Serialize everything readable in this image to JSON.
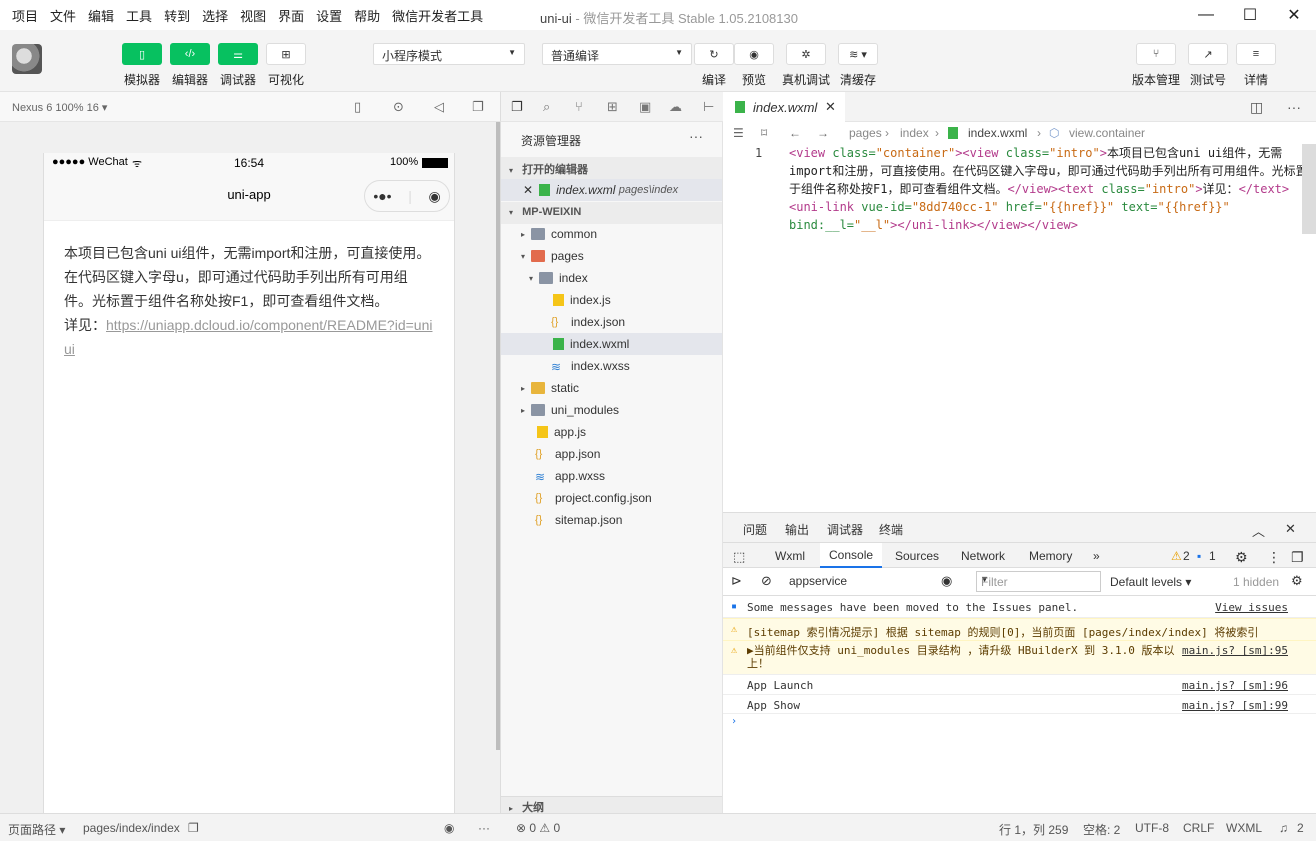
{
  "menubar": {
    "items": [
      "项目",
      "文件",
      "编辑",
      "工具",
      "转到",
      "选择",
      "视图",
      "界面",
      "设置",
      "帮助",
      "微信开发者工具"
    ],
    "title": "uni-ui",
    "subtitle": "- 微信开发者工具 Stable 1.05.2108130"
  },
  "toolbar": {
    "simulator": "模拟器",
    "editor": "编辑器",
    "debugger": "调试器",
    "visual": "可视化",
    "mode_select": "小程序模式",
    "compile_select": "普通编译",
    "compile": "编译",
    "preview": "预览",
    "real_debug": "真机调试",
    "clear_cache": "清缓存",
    "version_mgmt": "版本管理",
    "test_account": "测试号",
    "details": "详情"
  },
  "simulator": {
    "device": "Nexus 6 100% 16 ▾",
    "status_carrier": "●●●●● WeChat",
    "status_time": "16:54",
    "status_battery": "100%",
    "nav_title": "uni-app",
    "content_text": "本项目已包含uni ui组件，无需import和注册，可直接使用。在代码区键入字母u，即可通过代码助手列出所有可用组件。光标置于组件名称处按F1，即可查看组件文档。",
    "see_label": "详见：",
    "link": "https://uniapp.dcloud.io/component/README?id=uniui"
  },
  "explorer": {
    "title": "资源管理器",
    "open_editors": "打开的编辑器",
    "open_file": "index.wxml",
    "open_file_path": "pages\\index",
    "project": "MP-WEIXIN",
    "tree": [
      "common",
      "pages",
      "index",
      "index.js",
      "index.json",
      "index.wxml",
      "index.wxss",
      "static",
      "uni_modules",
      "app.js",
      "app.json",
      "app.wxss",
      "project.config.json",
      "sitemap.json"
    ],
    "outline": "大纲"
  },
  "editor": {
    "tab": "index.wxml",
    "breadcrumb": [
      "pages",
      "index",
      "index.wxml",
      "view.container"
    ],
    "line_number": "1",
    "code": {
      "t1": "<view",
      "a1": " class=",
      "s1": "\"container\"",
      "t2": "><view",
      "a2": " class=",
      "s2": "\"intro\"",
      "t3": ">",
      "x1": "本项目已包含uni ui组件，无需import和注册，可直接使用。在代码区键入字母u，即可通过代码助手列出所有可用组件。光标置于组件名称处按F1，即可查看组件文档。",
      "t4": "</view><text",
      "a3": " class=",
      "s3": "\"intro\"",
      "t5": ">",
      "x2": "详见：",
      "t6": "</text><uni-link",
      "a4": " vue-id=",
      "s4": "\"8dd740cc-1\"",
      "a5": " href=",
      "s5": "\"{{href}}\"",
      "a6": " text=",
      "s6": "\"{{href}}\"",
      "a7": " bind:__l=",
      "s7": "\"__l\"",
      "t7": "></uni-link></view></view>"
    }
  },
  "devtools": {
    "panel_tabs": [
      "问题",
      "输出",
      "调试器",
      "终端"
    ],
    "tabs": [
      "Wxml",
      "Console",
      "Sources",
      "Network",
      "Memory",
      "»"
    ],
    "warn_count": "2",
    "info_count": "1",
    "context": "appservice",
    "filter_placeholder": "Filter",
    "levels": "Default levels ▾",
    "hidden": "1 hidden",
    "messages": [
      {
        "text": "Some messages have been moved to the Issues panel.",
        "src": "View issues"
      },
      {
        "text": "[sitemap 索引情况提示] 根据 sitemap 的规则[0]，当前页面 [pages/index/index] 将被索引",
        "src": ""
      },
      {
        "text": "▶当前组件仅支持 uni_modules 目录结构 ，请升级 HBuilderX 到 3.1.0 版本以上！",
        "src": "main.js? [sm]:95"
      },
      {
        "text": "App Launch",
        "src": "main.js? [sm]:96"
      },
      {
        "text": "App Show",
        "src": "main.js? [sm]:99"
      }
    ]
  },
  "statusbar": {
    "page_path_label": "页面路径 ▾",
    "page_path": "pages/index/index",
    "errors": "⊗ 0 ⚠ 0",
    "position": "行 1，列 259",
    "spaces": "空格: 2",
    "encoding": "UTF-8",
    "eol": "CRLF",
    "language": "WXML",
    "notifications": "2"
  },
  "colors": {
    "accent": "#07c160",
    "link": "#1a73e8",
    "warn_bg": "#fffbe5"
  }
}
